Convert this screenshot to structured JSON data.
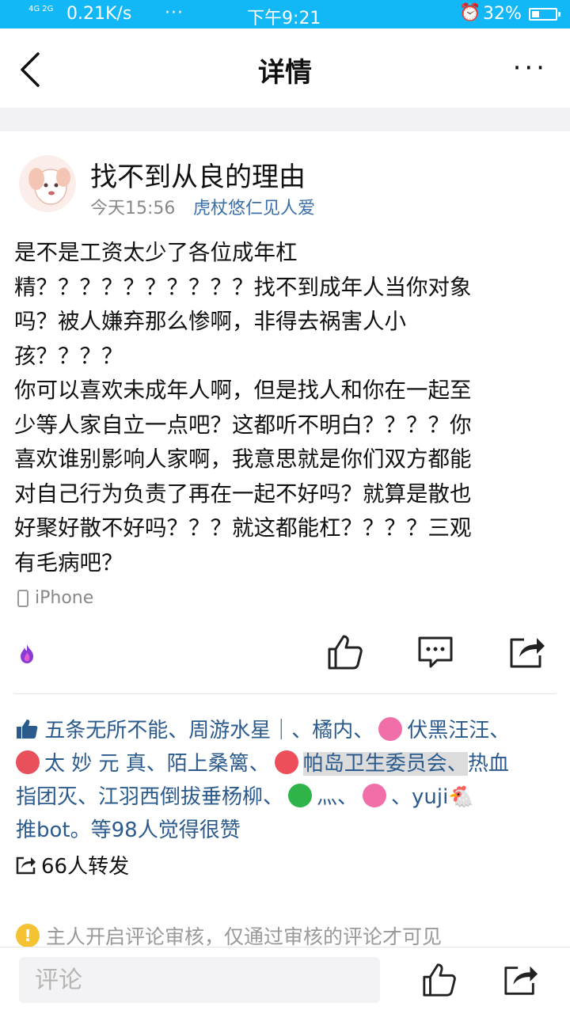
{
  "status_bar": {
    "signal": "4G 2G",
    "network_speed": "0.21K/s",
    "more": "···",
    "time": "下午9:21",
    "battery": "32%"
  },
  "nav": {
    "title": "详情",
    "more": "···"
  },
  "post": {
    "username": "找不到从良的理由",
    "time": "今天15:56",
    "tag": "虎杖悠仁见人爱",
    "content_lines": [
      "是不是工资太少了各位成年杠",
      "精？？？？？？？？？？找不到成年人当你对象",
      "吗？被人嫌弃那么惨啊，非得去祸害人小",
      "孩？？？？",
      "你可以喜欢未成年人啊，但是找人和你在一起至",
      "少等人家自立一点吧？这都听不明白？？？？你",
      "喜欢谁别影响人家啊，我意思就是你们双方都能",
      "对自己行为负责了再在一起不好吗？就算是散也",
      "好聚好散不好吗？？？就这都能杠？？？？三观",
      "有毛病吧？"
    ],
    "device": "iPhone"
  },
  "likes": {
    "names": [
      "五条无所不能、周游水星｜、橘内、",
      "伏黑汪汪、",
      "太 妙 元 真、陌上桑篱、",
      "帕岛卫生委员会、",
      "热血",
      "指团灭、江羽西倒拔垂杨柳、",
      "灬、",
      "、yuji",
      "推bot。等98人觉得很赞"
    ],
    "badge_colors": [
      "#f06fa8",
      "#e8505b",
      "#ee4d5a",
      "#2fb44a",
      "#f06fa8"
    ]
  },
  "forward": {
    "label": "66人转发"
  },
  "notice": {
    "text": "主人开启评论审核，仅通过审核的评论才可见"
  },
  "comment": {
    "placeholder": "评论"
  },
  "colors": {
    "status_bar": "#12b7f5",
    "link": "#2b5a8c",
    "tag": "#3b6fa8"
  }
}
